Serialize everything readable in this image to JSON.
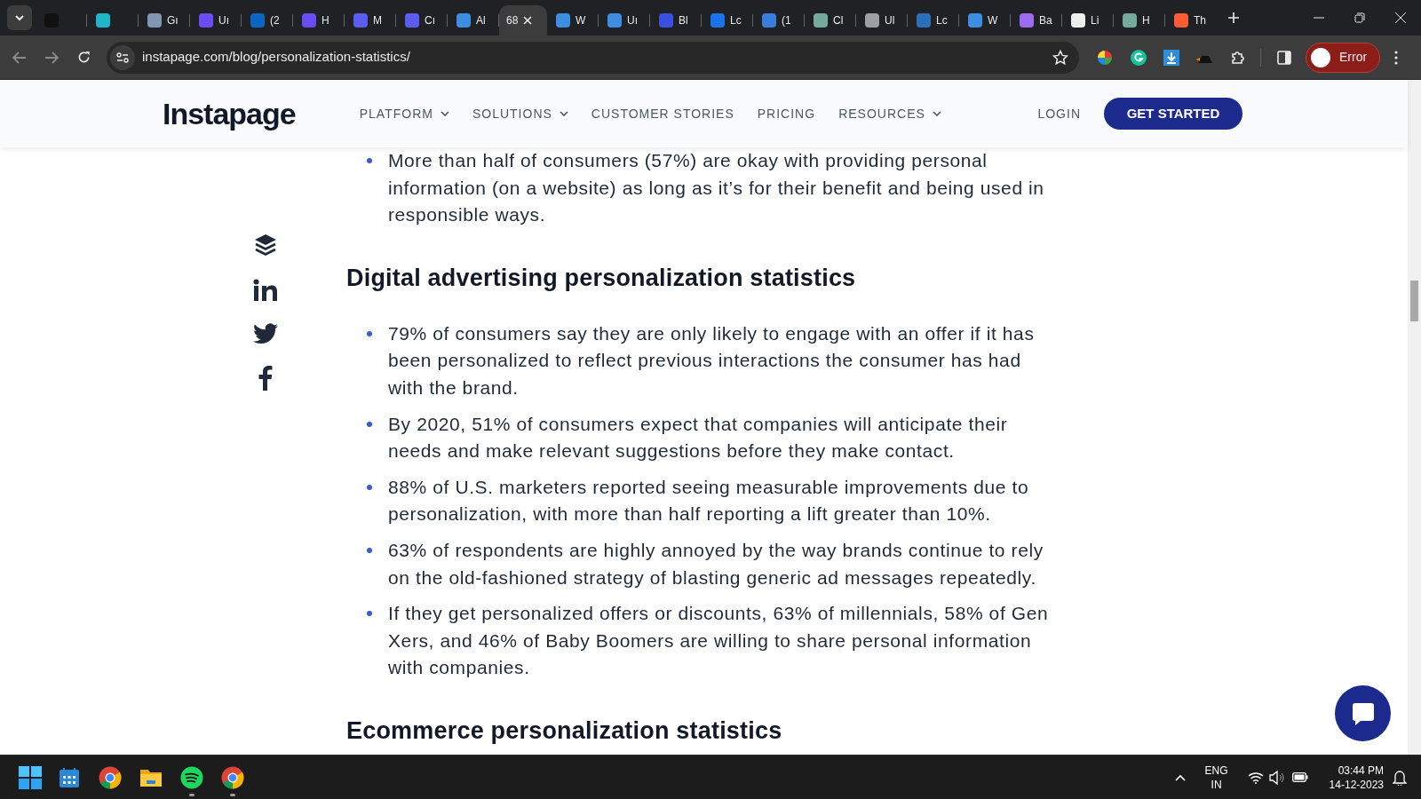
{
  "browser": {
    "tabs": [
      {
        "color": "#111111",
        "selected": false
      },
      {
        "color": "#1fb6c9",
        "selected": false
      },
      {
        "label": "Gı",
        "color": "#7f98b0",
        "selected": false
      },
      {
        "label": "Uı",
        "color": "#6a4cf5",
        "selected": false
      },
      {
        "label": "(2",
        "color": "#0a66c2",
        "selected": false
      },
      {
        "label": "H",
        "color": "#6a4cf5",
        "selected": false
      },
      {
        "label": "M",
        "color": "#5b5cf0",
        "selected": false
      },
      {
        "label": "Cı",
        "color": "#5b5cf0",
        "selected": false
      },
      {
        "label": "Al",
        "color": "#3d8ee0",
        "selected": false
      },
      {
        "label": "68",
        "selected": true
      },
      {
        "label": "W",
        "color": "#3d8ee0",
        "selected": false
      },
      {
        "label": "Uı",
        "color": "#3d8ee0",
        "selected": false
      },
      {
        "label": "Bl",
        "color": "#3b4fe0",
        "selected": false
      },
      {
        "label": "Lc",
        "color": "#1a73e8",
        "selected": false
      },
      {
        "label": "(1",
        "color": "#3b7ddd",
        "selected": false
      },
      {
        "label": "Cl",
        "color": "#74aa9c",
        "selected": false
      },
      {
        "label": "Ul",
        "color": "#9aa0a6",
        "selected": false
      },
      {
        "label": "Lc",
        "color": "#2a6fb8",
        "selected": false
      },
      {
        "label": "W",
        "color": "#3d8ee0",
        "selected": false
      },
      {
        "label": "Ba",
        "color": "#9b6cf0",
        "selected": false
      },
      {
        "label": "Li",
        "color": "#eeeeee",
        "selected": false
      },
      {
        "label": "H",
        "color": "#74aa9c",
        "selected": false
      },
      {
        "label": "Th",
        "color": "#ff5c35",
        "selected": false
      }
    ],
    "address": "instapage.com/blog/personalization-statistics/",
    "profile_button": "Error"
  },
  "site": {
    "logo": "Instapage",
    "nav": [
      {
        "label": "PLATFORM",
        "dropdown": true
      },
      {
        "label": "SOLUTIONS",
        "dropdown": true
      },
      {
        "label": "CUSTOMER STORIES",
        "dropdown": false
      },
      {
        "label": "PRICING",
        "dropdown": false
      },
      {
        "label": "RESOURCES",
        "dropdown": true
      }
    ],
    "login": "LOGIN",
    "cta": "GET STARTED"
  },
  "article": {
    "intro_bullets": [
      "More than half of consumers (57%) are okay with providing personal information (on a website) as long as it’s for their benefit and being used in responsible ways."
    ],
    "sections": [
      {
        "heading": "Digital advertising personalization statistics",
        "bullets": [
          "79% of consumers say they are only likely to engage with an offer if it has been personalized to reflect previous interactions the consumer has had with the brand.",
          "By 2020, 51% of consumers expect that companies will anticipate their needs and make relevant suggestions before they make contact.",
          "88% of U.S. marketers reported seeing measurable improvements due to personalization, with more than half reporting a lift greater than 10%.",
          "63% of respondents are highly annoyed by the way brands continue to rely on the old-fashioned strategy of blasting generic ad messages repeatedly.",
          "If they get personalized offers or discounts, 63% of millennials, 58% of Gen Xers, and 46% of Baby Boomers are willing to share personal information with companies."
        ]
      },
      {
        "heading": "Ecommerce personalization statistics"
      }
    ]
  },
  "taskbar": {
    "apps": [
      {
        "kind": "calendar",
        "running": false
      },
      {
        "kind": "chrome",
        "running": false
      },
      {
        "kind": "folder",
        "running": false
      },
      {
        "kind": "spotify",
        "running": true
      },
      {
        "kind": "chrome",
        "running": true
      }
    ],
    "language": "ENG",
    "region": "IN",
    "time": "03:44 PM",
    "date": "14-12-2023"
  }
}
